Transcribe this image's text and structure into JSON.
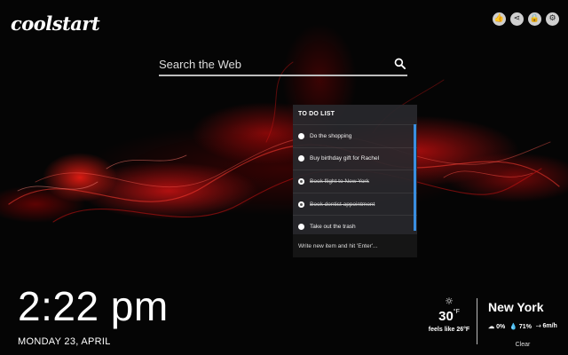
{
  "logo": "coolstart",
  "top_icons": [
    {
      "name": "thumbs-up-icon",
      "glyph": "👍"
    },
    {
      "name": "share-icon",
      "glyph": "⋖"
    },
    {
      "name": "lock-icon",
      "glyph": "🔒"
    },
    {
      "name": "gear-icon",
      "glyph": "⚙"
    }
  ],
  "search": {
    "placeholder": "Search the Web"
  },
  "todo": {
    "title": "TO DO LIST",
    "items": [
      {
        "label": "Do the shopping",
        "done": false
      },
      {
        "label": "Buy birthday gift for Rachel",
        "done": false
      },
      {
        "label": "Book flight to New York",
        "done": true
      },
      {
        "label": "Book dentist appointment",
        "done": true
      },
      {
        "label": "Take out the trash",
        "done": false
      }
    ],
    "input_placeholder": "Write new item and hit 'Enter'..."
  },
  "clock": {
    "time": "2:22 pm",
    "date": "MONDAY 23, APRIL"
  },
  "weather": {
    "icon": "☼",
    "temp": "30",
    "unit": "°F",
    "feels_like": "feels like 26°F",
    "city": "New York",
    "precip": "0%",
    "humidity": "71%",
    "wind": "6m/h",
    "condition": "Clear"
  },
  "colors": {
    "accent": "#3a8ee0",
    "background_glow": "#e01414"
  }
}
